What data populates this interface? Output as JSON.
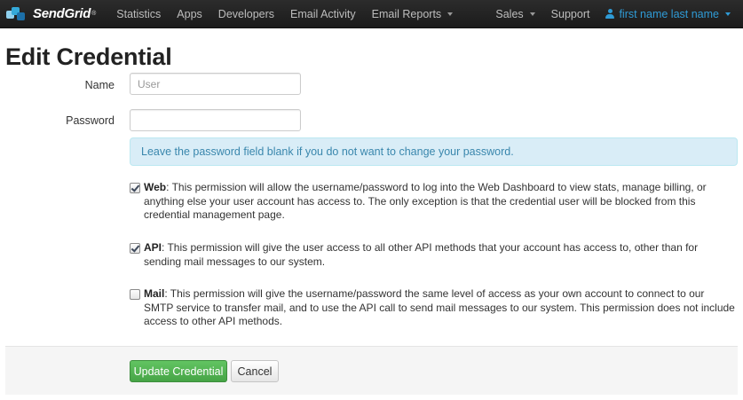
{
  "navbar": {
    "brand": "SendGrid",
    "brand_mark": "®",
    "items": [
      {
        "label": "Statistics"
      },
      {
        "label": "Apps"
      },
      {
        "label": "Developers"
      },
      {
        "label": "Email Activity"
      },
      {
        "label": "Email Reports"
      }
    ],
    "right_items": [
      {
        "label": "Sales"
      },
      {
        "label": "Support"
      }
    ],
    "user": "first name last name",
    "logo_colors": [
      "#34a9d9",
      "#1c6fa8",
      "#8fd0ee"
    ],
    "accent_color": "#2f9bd6"
  },
  "page": {
    "title": "Edit Credential"
  },
  "form": {
    "name_label": "Name",
    "name_placeholder": "User",
    "name_value": "",
    "password_label": "Password",
    "password_value": "",
    "info_alert": "Leave the password field blank if you do not want to change your password.",
    "permissions": [
      {
        "name": "Web",
        "checked": true,
        "description": ": This permission will allow the username/password to log into the Web Dashboard to view stats, manage billing, or anything else your user account has access to. The only exception is that the credential user will be blocked from this credential management page."
      },
      {
        "name": "API",
        "checked": true,
        "description": ": This permission will give the user access to all other API methods that your account has access to, other than for sending mail messages to our system."
      },
      {
        "name": "Mail",
        "checked": false,
        "description": ": This permission will give the username/password the same level of access as your own account to connect to our SMTP service to transfer mail, and to use the API call to send mail messages to our system. This permission does not include access to other API methods."
      }
    ],
    "submit_label": "Update Credential",
    "cancel_label": "Cancel"
  }
}
